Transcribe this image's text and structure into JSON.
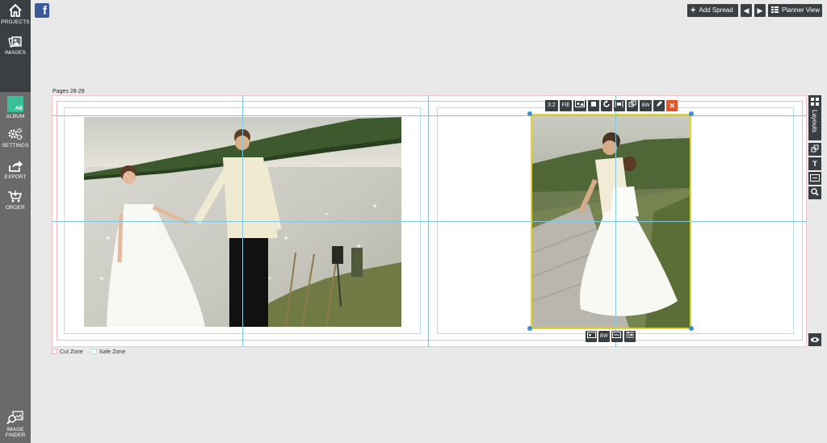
{
  "sidebar": {
    "projects_label": "PROJECTS",
    "images_label": "IMAGES",
    "album_label": "ALBUM",
    "album_badge": "AB",
    "settings_label": "SETTINGS",
    "export_label": "EXPORT",
    "order_label": "ORDER",
    "image_finder_label_1": "IMAGE",
    "image_finder_label_2": "FINDER"
  },
  "header": {
    "facebook_glyph": "f",
    "add_spread_label": "Add Spread",
    "prev_glyph": "◀",
    "next_glyph": "▶",
    "planner_view_label": "Planner View"
  },
  "spread": {
    "pages_label": "Pages 28-29"
  },
  "photo_toolbar": {
    "ratio_label": "3:2",
    "fill_label": "Fill",
    "bw_label": "BW",
    "delete_glyph": "✕"
  },
  "photo_toolbar_bottom": {
    "bw_label": "BW"
  },
  "right_toolbar": {
    "layouts_label": "Layouts",
    "text_glyph": "T"
  },
  "legend": {
    "cut_zone_label": "Cut Zone",
    "safe_zone_label": "Safe Zone",
    "cut_zone_color": "#f2b7b7",
    "safe_zone_color": "#b6e0ea"
  },
  "colors": {
    "sidebar_dark": "#3a3f44",
    "sidebar_gray": "#6a6a6a",
    "album_accent": "#3bbf9a",
    "selection_frame": "#e4d428",
    "handle": "#3d8fd6",
    "delete_button": "#e8532a",
    "facebook_blue": "#3b5998"
  }
}
